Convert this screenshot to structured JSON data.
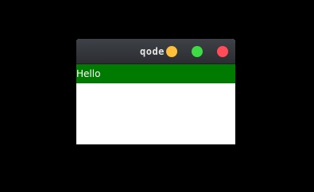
{
  "window": {
    "app_name": "qode",
    "controls": {
      "minimize_color": "#ffbf3a",
      "maximize_color": "#3ddc44",
      "close_color": "#ff4c58"
    }
  },
  "content": {
    "label": "Hello",
    "bar_color": "#007a00"
  }
}
